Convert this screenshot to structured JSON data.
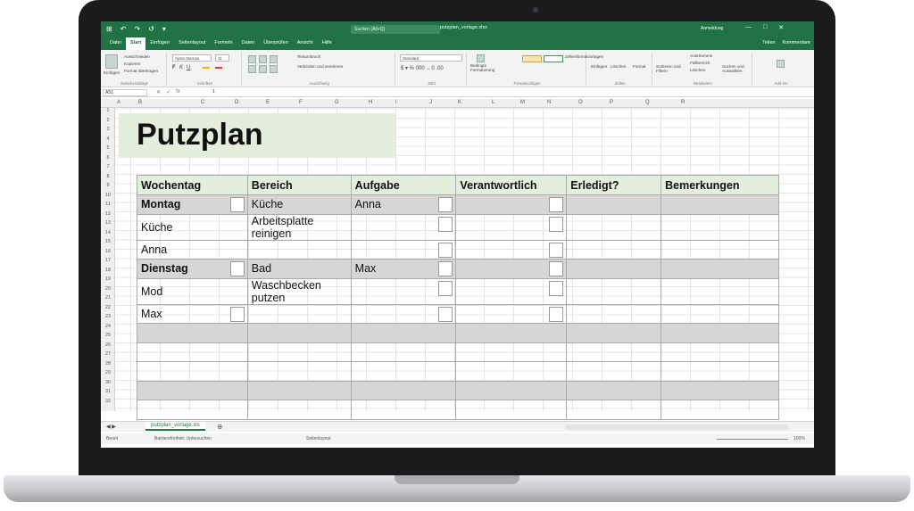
{
  "app": {
    "search_placeholder": "Suchen (Alt+Q)",
    "doc_title": "putzplan_vorlage.xlsx",
    "account": "Anmeldung",
    "quick_access": [
      "↶",
      "↷",
      "↺",
      "▾"
    ],
    "window_buttons": [
      "—",
      "□",
      "✕"
    ]
  },
  "menu": {
    "tabs": [
      "Datei",
      "Start",
      "Einfügen",
      "Seitenlayout",
      "Formeln",
      "Daten",
      "Überprüfen",
      "Ansicht",
      "Hilfe"
    ],
    "active": "Start",
    "right": [
      "Teilen",
      "Kommentare"
    ]
  },
  "ribbon": {
    "clipboard": {
      "paste": "Einfügen",
      "cut": "Ausschneiden",
      "copy": "Kopieren",
      "format": "Format übertragen",
      "label": "Zwischenablage"
    },
    "font": {
      "name": "Aptos Narrow",
      "size": "11",
      "label": "Schriftart"
    },
    "alignment": {
      "wrap": "Textumbruch",
      "merge": "Verbinden und zentrieren",
      "label": "Ausrichtung"
    },
    "number": {
      "format": "Standard",
      "label": "Zahl"
    },
    "styles": {
      "conditional": "Bedingte Formatierung",
      "table": "Als Tabelle formatieren",
      "cellstyles": "Zellenformatvorlagen",
      "label": "Formatvorlagen"
    },
    "cells": {
      "insert": "Einfügen",
      "delete": "Löschen",
      "format": "Format",
      "label": "Zellen"
    },
    "editing": {
      "autosum": "AutoSumme",
      "fill": "Füllbereich",
      "clear": "Löschen",
      "sort": "Sortieren und Filtern",
      "find": "Suchen und Auswählen",
      "label": "Bearbeiten"
    },
    "addins": {
      "label": "Add-Ins"
    }
  },
  "formula": {
    "namebox": "A51",
    "content": "1",
    "fx": "fx"
  },
  "columns": [
    "A",
    "B",
    "C",
    "D",
    "E",
    "F",
    "G",
    "H",
    "I",
    "J",
    "K",
    "L",
    "M",
    "N",
    "O",
    "P",
    "Q",
    "R"
  ],
  "rows": [
    "1",
    "2",
    "3",
    "4",
    "5",
    "6",
    "7",
    "8",
    "9",
    "10",
    "11",
    "12",
    "13",
    "14",
    "15",
    "16",
    "17",
    "18",
    "19",
    "20",
    "21",
    "22",
    "23",
    "24",
    "25",
    "26",
    "27",
    "28",
    "29",
    "30",
    "31",
    "32"
  ],
  "sheet": {
    "title": "Putzplan",
    "headers": [
      "Wochentag",
      "Bereich",
      "Aufgabe",
      "Verantwortlich",
      "Erledigt?",
      "Bemerkungen"
    ],
    "rows": [
      {
        "c": [
          "Montag",
          "Küche",
          "Anna",
          "",
          "",
          ""
        ],
        "bold": true,
        "grey": true,
        "chk": [
          true,
          false,
          true,
          true
        ]
      },
      {
        "c": [
          "Küche",
          "Arbeitsplatte reinigen",
          "",
          "",
          "",
          ""
        ],
        "bold": false,
        "grey": false,
        "chk": [
          false,
          false,
          true,
          true
        ]
      },
      {
        "c": [
          "Anna",
          "",
          "",
          "",
          "",
          ""
        ],
        "bold": false,
        "grey": false,
        "chk": [
          false,
          false,
          true,
          true
        ]
      },
      {
        "c": [
          "Dienstag",
          "Bad",
          "Max",
          "",
          "",
          ""
        ],
        "bold": true,
        "grey": true,
        "chk": [
          true,
          false,
          true,
          true
        ]
      },
      {
        "c": [
          "Mod",
          "Waschbecken putzen",
          "",
          "",
          "",
          ""
        ],
        "bold": false,
        "grey": false,
        "chk": [
          false,
          false,
          true,
          true
        ]
      },
      {
        "c": [
          "Max",
          "",
          "",
          "",
          "",
          ""
        ],
        "bold": false,
        "grey": false,
        "chk": [
          true,
          false,
          true,
          true
        ]
      },
      {
        "c": [
          "",
          "",
          "",
          "",
          "",
          ""
        ],
        "bold": false,
        "grey": true,
        "chk": [
          false,
          false,
          false,
          false
        ]
      },
      {
        "c": [
          "",
          "",
          "",
          "",
          "",
          ""
        ],
        "bold": false,
        "grey": false,
        "chk": [
          false,
          false,
          false,
          false
        ]
      },
      {
        "c": [
          "",
          "",
          "",
          "",
          "",
          ""
        ],
        "bold": false,
        "grey": false,
        "chk": [
          false,
          false,
          false,
          false
        ]
      },
      {
        "c": [
          "",
          "",
          "",
          "",
          "",
          ""
        ],
        "bold": false,
        "grey": true,
        "chk": [
          false,
          false,
          false,
          false
        ]
      },
      {
        "c": [
          "",
          "",
          "",
          "",
          "",
          ""
        ],
        "bold": false,
        "grey": false,
        "chk": [
          false,
          false,
          false,
          false
        ]
      }
    ]
  },
  "sheettab": "putzplan_vorlage.xls",
  "status": {
    "ready": "Bereit",
    "accessibility": "Barrierefreiheit: Untersuchen",
    "view": "Seitenlayout",
    "zoom": "100%"
  }
}
